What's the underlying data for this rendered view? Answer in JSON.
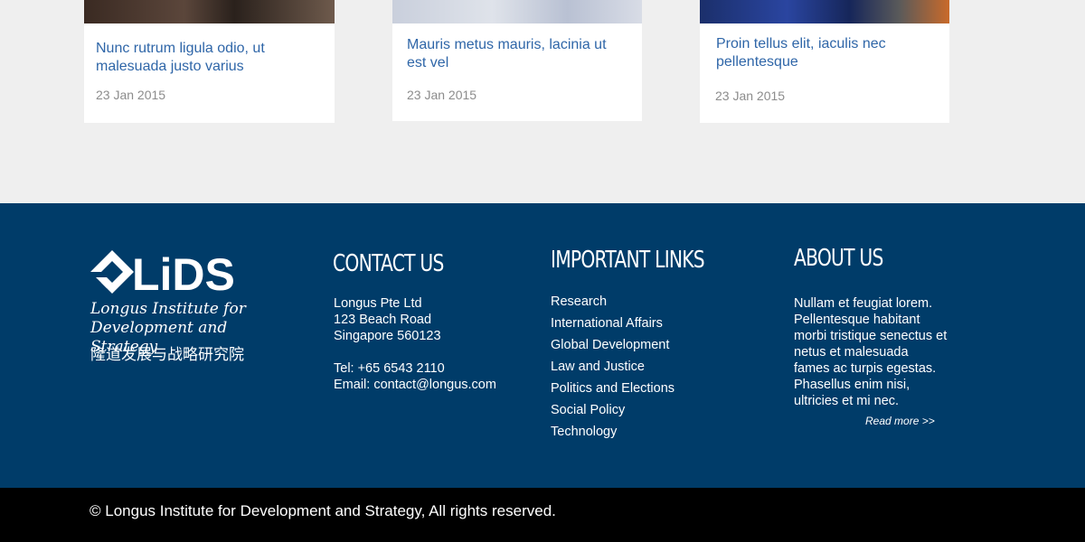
{
  "news_cards": [
    {
      "title": "Nunc rutrum ligula odio, ut malesuada justo varius",
      "date": "23 Jan 2015"
    },
    {
      "title": "Mauris metus mauris, lacinia ut est vel",
      "date": "23 Jan 2015"
    },
    {
      "title": "Proin tellus elit, iaculis nec pellentesque",
      "date": "23 Jan 2015"
    }
  ],
  "footer": {
    "logo": {
      "mark_text": "LiDS",
      "name_en": "Longus Institute for Development and Strategy",
      "name_cn": "隆道发展与战略研究院"
    },
    "contact": {
      "title": "CONTACT US",
      "company": "Longus Pte Ltd",
      "address1": "123 Beach Road",
      "address2": "Singapore 560123",
      "tel": "Tel: +65 6543 2110",
      "email": "Email: contact@longus.com"
    },
    "links": {
      "title": "IMPORTANT LINKS",
      "items": [
        "Research",
        "International Affairs",
        "Global Development",
        "Law and Justice",
        "Politics and Elections",
        "Social Policy",
        "Technology"
      ]
    },
    "about": {
      "title": "ABOUT US",
      "text": "Nullam et feugiat lorem. Pellentesque habitant morbi tristique senectus et netus et malesuada fames ac turpis egestas. Phasellus enim nisi, ultricies et mi nec.",
      "read_more": "Read more >>"
    }
  },
  "copyright": "© Longus Institute for Development and Strategy, All rights reserved.",
  "colors": {
    "footer_bg": "#003c69",
    "link_blue": "#2f66a8",
    "date_gray": "#8c8c8c",
    "bottom_bar": "#000000",
    "page_bg": "#efefef"
  }
}
